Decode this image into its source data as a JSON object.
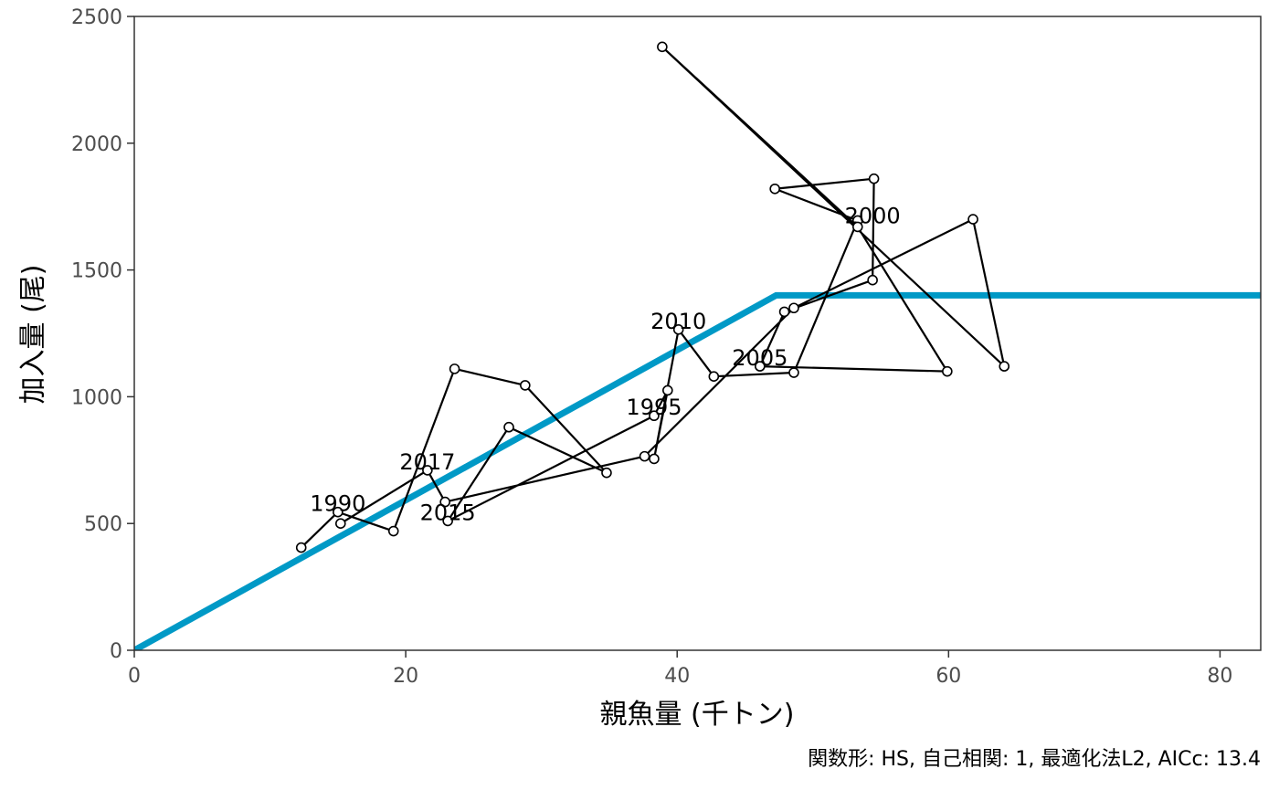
{
  "chart_data": {
    "type": "scatter",
    "xlabel": "親魚量 (千トン)",
    "ylabel": "加入量 (尾)",
    "caption": "関数形: HS, 自己相関: 1, 最適化法L2, AICc: 13.4",
    "xlim": [
      0,
      83
    ],
    "ylim": [
      0,
      2500
    ],
    "x_ticks": [
      0,
      20,
      40,
      60,
      80
    ],
    "y_ticks": [
      0,
      500,
      1000,
      1500,
      2000,
      2500
    ],
    "grid": false,
    "colors": {
      "fit_line": "#0099c6",
      "observed": "#000000",
      "point_fill": "#ffffff"
    },
    "series": [
      {
        "type": "line-with-points",
        "points": [
          {
            "x": 12.3,
            "y": 405
          },
          {
            "x": 15.0,
            "y": 545
          },
          {
            "x": 19.1,
            "y": 470
          },
          {
            "x": 23.6,
            "y": 1110
          },
          {
            "x": 28.8,
            "y": 1045
          },
          {
            "x": 34.8,
            "y": 700
          },
          {
            "x": 27.6,
            "y": 880
          },
          {
            "x": 23.1,
            "y": 510
          },
          {
            "x": 38.3,
            "y": 925
          },
          {
            "x": 39.3,
            "y": 1025
          },
          {
            "x": 38.3,
            "y": 755
          },
          {
            "x": 40.1,
            "y": 1265
          },
          {
            "x": 42.7,
            "y": 1080
          },
          {
            "x": 48.6,
            "y": 1095
          },
          {
            "x": 53.3,
            "y": 1695
          },
          {
            "x": 47.2,
            "y": 1820
          },
          {
            "x": 54.5,
            "y": 1860
          },
          {
            "x": 54.4,
            "y": 1460
          },
          {
            "x": 47.9,
            "y": 1335
          },
          {
            "x": 46.1,
            "y": 1120
          },
          {
            "x": 59.9,
            "y": 1100
          },
          {
            "x": 53.3,
            "y": 1670
          },
          {
            "x": 38.9,
            "y": 2380
          },
          {
            "x": 64.1,
            "y": 1120
          },
          {
            "x": 61.8,
            "y": 1700
          },
          {
            "x": 48.6,
            "y": 1350
          },
          {
            "x": 37.6,
            "y": 765
          },
          {
            "x": 22.9,
            "y": 585
          },
          {
            "x": 21.6,
            "y": 710
          },
          {
            "x": 15.2,
            "y": 500
          }
        ]
      },
      {
        "type": "hockey-stick-fit",
        "points": [
          {
            "x": 0,
            "y": 0
          },
          {
            "x": 47.3,
            "y": 1400
          },
          {
            "x": 83,
            "y": 1400
          }
        ]
      }
    ],
    "annotations": [
      {
        "text": "1990",
        "x": 15.0,
        "y": 545
      },
      {
        "text": "1995",
        "x": 38.3,
        "y": 925
      },
      {
        "text": "2000",
        "x": 54.4,
        "y": 1680
      },
      {
        "text": "2005",
        "x": 46.1,
        "y": 1120
      },
      {
        "text": "2010",
        "x": 40.1,
        "y": 1265
      },
      {
        "text": "2015",
        "x": 23.1,
        "y": 510
      },
      {
        "text": "2017",
        "x": 21.6,
        "y": 710
      }
    ]
  }
}
